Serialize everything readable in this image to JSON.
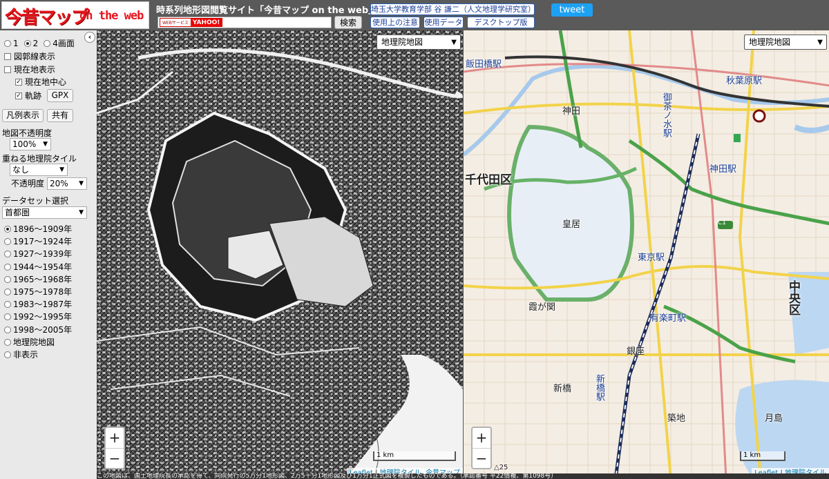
{
  "header": {
    "logo_jp": "今昔マップ",
    "logo_en": "on the web",
    "site_title": "時系列地形図閲覧サイト「今昔マップ on the web」",
    "yahoo_web_label": "WEBサービス",
    "yahoo_label": "YAHOO!",
    "search_value": "",
    "search_button": "検索",
    "author_link": "埼玉大学教育学部 谷 謙二（人文地理学研究室）",
    "usage_notes": "使用上の注意",
    "data_used": "使用データ",
    "desktop_version": "デスクトップ版",
    "tweet": "tweet"
  },
  "panel": {
    "collapse": "‹",
    "screen_modes": [
      {
        "label": "1",
        "selected": false
      },
      {
        "label": "2",
        "selected": true
      },
      {
        "label": "4画面",
        "selected": false
      }
    ],
    "options": [
      {
        "label": "図郭線表示",
        "checked": false
      },
      {
        "label": "現在地表示",
        "checked": false
      },
      {
        "label": "現在地中心",
        "checked": true
      },
      {
        "label": "軌跡",
        "checked": true
      }
    ],
    "gpx_button": "GPX",
    "legend_button": "凡例表示",
    "share_button": "共有",
    "opacity_label": "地図不透明度",
    "opacity_value": "100%",
    "overlay_label": "重ねる地理院タイル",
    "overlay_value": "なし",
    "overlay_opacity_label": "不透明度",
    "overlay_opacity_value": "20%",
    "dataset_label": "データセット選択",
    "dataset_value": "首都圏",
    "periods": [
      {
        "label": "1896～1909年",
        "selected": true
      },
      {
        "label": "1917～1924年",
        "selected": false
      },
      {
        "label": "1927～1939年",
        "selected": false
      },
      {
        "label": "1944～1954年",
        "selected": false
      },
      {
        "label": "1965～1968年",
        "selected": false
      },
      {
        "label": "1975～1978年",
        "selected": false
      },
      {
        "label": "1983～1987年",
        "selected": false
      },
      {
        "label": "1992～1995年",
        "selected": false
      },
      {
        "label": "1998～2005年",
        "selected": false
      },
      {
        "label": "地理院地図",
        "selected": false
      },
      {
        "label": "非表示",
        "selected": false
      }
    ]
  },
  "map_left": {
    "layer_select": "地理院地図",
    "zoom_in": "+",
    "zoom_out": "−",
    "scale": "1 km",
    "attribution_leaflet": "Leaflet",
    "attribution_sep": " | ",
    "attribution_rest": "地理院タイル, 今昔マップ"
  },
  "map_right": {
    "layer_select": "地理院地図",
    "zoom_in": "+",
    "zoom_out": "−",
    "scale": "1 km",
    "attribution_leaflet": "Leaflet",
    "attribution_sep": " | ",
    "attribution_rest": "地理院タイル",
    "labels": {
      "iidabashi": "飯田橋駅",
      "akihabara": "秋葉原駅",
      "kanda": "神田",
      "ochanomizu": "御茶ノ水駅",
      "chiyoda": "千代田区",
      "kokyo": "皇居",
      "kanda_st": "神田駅",
      "tokyo_st": "東京駅",
      "kasumigaseki": "霞が関",
      "yurakucho": "有楽町駅",
      "chuo": "中央区",
      "ginza": "銀座",
      "shinbashi": "新橋",
      "shinbashi_st": "新橋駅",
      "tsukiji": "築地",
      "tsukishima": "月島",
      "route_c1": "C1",
      "triangle_25": "△25"
    }
  },
  "footnote": "この地図は、国土地理院長の承認を得て、同院発行の5万分1地形図、2万5千分1地形図及び1万分1正式図を複製したものである。（承認番号 平22情複、第1098号）",
  "colors": {
    "header_bg": "#5a5a5a",
    "panel_bg": "#e9e9e9",
    "logo_red": "#e8141c",
    "tweet_blue": "#1da1f2",
    "link_blue": "#1a3d9a"
  }
}
